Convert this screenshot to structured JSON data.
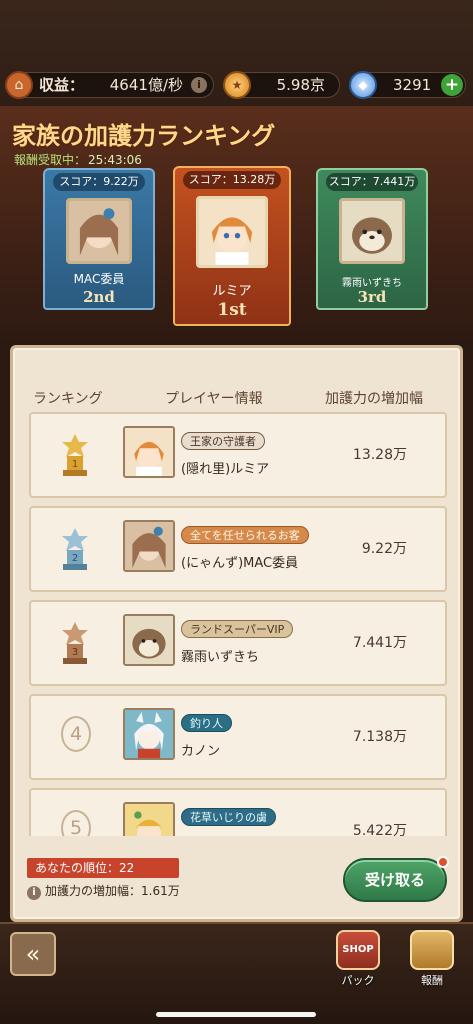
{
  "resources": {
    "income_label": "収益：",
    "income_value": "4641億/秒",
    "gold_value": "5.98京",
    "gem_value": "3291"
  },
  "header": {
    "title": "家族の加護力ランキング",
    "timer_label": "報酬受取中：",
    "timer_value": "25:43:06"
  },
  "podium": [
    {
      "score": "スコア：13.28万",
      "name": "ルミア",
      "place": "1st"
    },
    {
      "score": "スコア：9.22万",
      "name": "MAC委員",
      "place": "2nd"
    },
    {
      "score": "スコア：7.441万",
      "name": "霧雨いずきち",
      "place": "3rd"
    }
  ],
  "columns": {
    "rank": "ランキング",
    "player": "プレイヤー情報",
    "gain": "加護力の増加幅"
  },
  "rows": [
    {
      "rank": "1",
      "title": "王家の守護者",
      "name": "(隠れ里)ルミア",
      "gain": "13.28万"
    },
    {
      "rank": "2",
      "title": "全てを任せられるお客",
      "name": "(にゃんず)MAC委員",
      "gain": "9.22万"
    },
    {
      "rank": "3",
      "title": "ランドスーパーVIP",
      "name": "霧雨いずきち",
      "gain": "7.441万"
    },
    {
      "rank": "4",
      "title": "釣り人",
      "name": "カノン",
      "gain": "7.138万"
    },
    {
      "rank": "5",
      "title": "花草いじりの虜",
      "name": "",
      "gain": "5.422万"
    }
  ],
  "footer": {
    "my_rank": "あなたの順位：22",
    "my_gain": "加護力の増加幅：1.61万",
    "receive_label": "受け取る"
  },
  "nav": {
    "shop_icon_text": "SHOP",
    "pack_label": "パック",
    "reward_label": "報酬"
  },
  "colors": {
    "gold_medal": "#d9a032",
    "silver_medal": "#7aa7c0",
    "bronze_medal": "#b07a52",
    "receive_button": "#3f8f58",
    "my_rank_bg": "#c8432b"
  }
}
